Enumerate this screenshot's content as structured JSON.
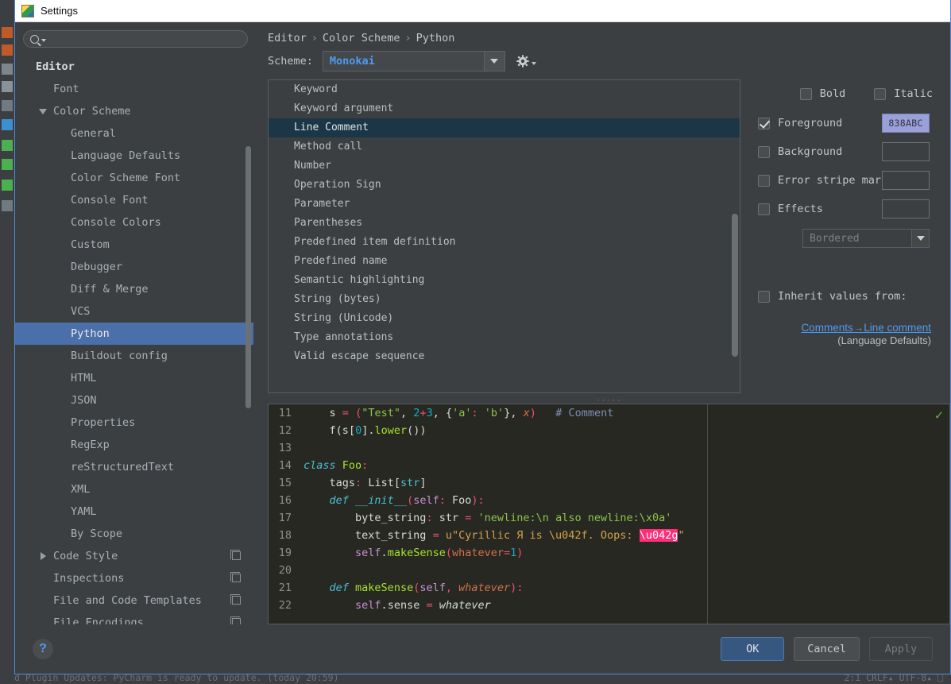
{
  "window": {
    "title": "Settings",
    "icon": "pycharm-icon"
  },
  "search": {
    "value": "",
    "placeholder": "",
    "icon": "search-icon"
  },
  "sidebar": {
    "items": [
      {
        "label": "Editor",
        "indent": 0,
        "bold": true,
        "twisty": "none",
        "selected": false,
        "copy": false
      },
      {
        "label": "Font",
        "indent": 1,
        "bold": false,
        "twisty": "none",
        "selected": false,
        "copy": false
      },
      {
        "label": "Color Scheme",
        "indent": 1,
        "bold": false,
        "twisty": "down",
        "selected": false,
        "copy": false
      },
      {
        "label": "General",
        "indent": 2,
        "bold": false,
        "twisty": "none",
        "selected": false,
        "copy": false
      },
      {
        "label": "Language Defaults",
        "indent": 2,
        "bold": false,
        "twisty": "none",
        "selected": false,
        "copy": false
      },
      {
        "label": "Color Scheme Font",
        "indent": 2,
        "bold": false,
        "twisty": "none",
        "selected": false,
        "copy": false
      },
      {
        "label": "Console Font",
        "indent": 2,
        "bold": false,
        "twisty": "none",
        "selected": false,
        "copy": false
      },
      {
        "label": "Console Colors",
        "indent": 2,
        "bold": false,
        "twisty": "none",
        "selected": false,
        "copy": false
      },
      {
        "label": "Custom",
        "indent": 2,
        "bold": false,
        "twisty": "none",
        "selected": false,
        "copy": false
      },
      {
        "label": "Debugger",
        "indent": 2,
        "bold": false,
        "twisty": "none",
        "selected": false,
        "copy": false
      },
      {
        "label": "Diff & Merge",
        "indent": 2,
        "bold": false,
        "twisty": "none",
        "selected": false,
        "copy": false
      },
      {
        "label": "VCS",
        "indent": 2,
        "bold": false,
        "twisty": "none",
        "selected": false,
        "copy": false
      },
      {
        "label": "Python",
        "indent": 2,
        "bold": false,
        "twisty": "none",
        "selected": true,
        "copy": false
      },
      {
        "label": "Buildout config",
        "indent": 2,
        "bold": false,
        "twisty": "none",
        "selected": false,
        "copy": false
      },
      {
        "label": "HTML",
        "indent": 2,
        "bold": false,
        "twisty": "none",
        "selected": false,
        "copy": false
      },
      {
        "label": "JSON",
        "indent": 2,
        "bold": false,
        "twisty": "none",
        "selected": false,
        "copy": false
      },
      {
        "label": "Properties",
        "indent": 2,
        "bold": false,
        "twisty": "none",
        "selected": false,
        "copy": false
      },
      {
        "label": "RegExp",
        "indent": 2,
        "bold": false,
        "twisty": "none",
        "selected": false,
        "copy": false
      },
      {
        "label": "reStructuredText",
        "indent": 2,
        "bold": false,
        "twisty": "none",
        "selected": false,
        "copy": false
      },
      {
        "label": "XML",
        "indent": 2,
        "bold": false,
        "twisty": "none",
        "selected": false,
        "copy": false
      },
      {
        "label": "YAML",
        "indent": 2,
        "bold": false,
        "twisty": "none",
        "selected": false,
        "copy": false
      },
      {
        "label": "By Scope",
        "indent": 2,
        "bold": false,
        "twisty": "none",
        "selected": false,
        "copy": false
      },
      {
        "label": "Code Style",
        "indent": 1,
        "bold": false,
        "twisty": "right",
        "selected": false,
        "copy": true
      },
      {
        "label": "Inspections",
        "indent": 1,
        "bold": false,
        "twisty": "none",
        "selected": false,
        "copy": true
      },
      {
        "label": "File and Code Templates",
        "indent": 1,
        "bold": false,
        "twisty": "none",
        "selected": false,
        "copy": true
      },
      {
        "label": "File Encodings",
        "indent": 1,
        "bold": false,
        "twisty": "none",
        "selected": false,
        "copy": true
      }
    ]
  },
  "breadcrumb": {
    "parts": [
      "Editor",
      "Color Scheme",
      "Python"
    ],
    "separator": "›"
  },
  "scheme": {
    "label": "Scheme:",
    "value": "Monokai",
    "dropdown_icon": "chevron-down-icon",
    "gear_icon": "gear-icon"
  },
  "attributes": {
    "items": [
      {
        "label": "Keyword",
        "selected": false
      },
      {
        "label": "Keyword argument",
        "selected": false
      },
      {
        "label": "Line Comment",
        "selected": true
      },
      {
        "label": "Method call",
        "selected": false
      },
      {
        "label": "Number",
        "selected": false
      },
      {
        "label": "Operation Sign",
        "selected": false
      },
      {
        "label": "Parameter",
        "selected": false
      },
      {
        "label": "Parentheses",
        "selected": false
      },
      {
        "label": "Predefined item definition",
        "selected": false
      },
      {
        "label": "Predefined name",
        "selected": false
      },
      {
        "label": "Semantic highlighting",
        "selected": false
      },
      {
        "label": "String (bytes)",
        "selected": false
      },
      {
        "label": "String (Unicode)",
        "selected": false
      },
      {
        "label": "Type annotations",
        "selected": false
      },
      {
        "label": "Valid escape sequence",
        "selected": false
      }
    ]
  },
  "properties": {
    "bold": {
      "label": "Bold",
      "checked": false
    },
    "italic": {
      "label": "Italic",
      "checked": false
    },
    "foreground": {
      "label": "Foreground",
      "checked": true,
      "color_value": "838ABC",
      "swatch_color": "#9aa0d8"
    },
    "background": {
      "label": "Background",
      "checked": false,
      "color_value": ""
    },
    "error_stripe": {
      "label": "Error stripe mark",
      "checked": false,
      "color_value": ""
    },
    "effects": {
      "label": "Effects",
      "checked": false,
      "color_value": ""
    },
    "effect_type": {
      "value": "Bordered",
      "dropdown_icon": "chevron-down-icon"
    },
    "inherit": {
      "label": "Inherit values from:",
      "checked": false
    },
    "inherit_link": "Comments→Line comment",
    "inherit_source": "(Language Defaults)"
  },
  "preview": {
    "grip_icon": "resize-grip",
    "status_icon": "inspection-ok-checkmark",
    "lines": [
      {
        "n": "11",
        "tokens": [
          {
            "t": "    ",
            "c": "t-dot"
          },
          {
            "t": "s",
            "c": "t-def"
          },
          {
            "t": " ",
            "c": "t-def"
          },
          {
            "t": "=",
            "c": "t-op"
          },
          {
            "t": " ",
            "c": "t-def"
          },
          {
            "t": "(",
            "c": "t-punct"
          },
          {
            "t": "\"Test\"",
            "c": "t-str"
          },
          {
            "t": ",",
            "c": "t-def"
          },
          {
            "t": " ",
            "c": "t-def"
          },
          {
            "t": "2",
            "c": "t-num"
          },
          {
            "t": "+",
            "c": "t-op"
          },
          {
            "t": "3",
            "c": "t-num"
          },
          {
            "t": ",",
            "c": "t-def"
          },
          {
            "t": " ",
            "c": "t-def"
          },
          {
            "t": "{",
            "c": "t-def"
          },
          {
            "t": "'a'",
            "c": "t-str"
          },
          {
            "t": ":",
            "c": "t-punct"
          },
          {
            "t": " ",
            "c": "t-def"
          },
          {
            "t": "'b'",
            "c": "t-str"
          },
          {
            "t": "}",
            "c": "t-def"
          },
          {
            "t": ",",
            "c": "t-def"
          },
          {
            "t": " ",
            "c": "t-def"
          },
          {
            "t": "x",
            "c": "t-param"
          },
          {
            "t": ")",
            "c": "t-punct"
          },
          {
            "t": "   ",
            "c": "t-def"
          },
          {
            "t": "# Comment",
            "c": "t-cmt"
          }
        ]
      },
      {
        "n": "12",
        "tokens": [
          {
            "t": "    ",
            "c": "t-dot"
          },
          {
            "t": "f",
            "c": "t-def"
          },
          {
            "t": "(",
            "c": "t-def"
          },
          {
            "t": "s",
            "c": "t-def"
          },
          {
            "t": "[",
            "c": "t-def"
          },
          {
            "t": "0",
            "c": "t-num"
          },
          {
            "t": "]",
            "c": "t-def"
          },
          {
            "t": ".",
            "c": "t-def"
          },
          {
            "t": "lower",
            "c": "t-fn"
          },
          {
            "t": "()",
            "c": "t-def"
          },
          {
            "t": ")",
            "c": "t-def"
          }
        ]
      },
      {
        "n": "13",
        "tokens": []
      },
      {
        "n": "14",
        "tokens": [
          {
            "t": "class",
            "c": "t-kw"
          },
          {
            "t": " ",
            "c": "t-def"
          },
          {
            "t": "Foo",
            "c": "t-cls"
          },
          {
            "t": ":",
            "c": "t-punct"
          }
        ]
      },
      {
        "n": "15",
        "tokens": [
          {
            "t": "    ",
            "c": "t-dot"
          },
          {
            "t": "tags",
            "c": "t-def"
          },
          {
            "t": ":",
            "c": "t-punct"
          },
          {
            "t": " ",
            "c": "t-def"
          },
          {
            "t": "List",
            "c": "t-def"
          },
          {
            "t": "[",
            "c": "t-def"
          },
          {
            "t": "str",
            "c": "t-ann"
          },
          {
            "t": "]",
            "c": "t-def"
          }
        ]
      },
      {
        "n": "16",
        "tokens": [
          {
            "t": "    ",
            "c": "t-dot"
          },
          {
            "t": "def",
            "c": "t-kw"
          },
          {
            "t": " ",
            "c": "t-def"
          },
          {
            "t": "__init__",
            "c": "t-kw"
          },
          {
            "t": "(",
            "c": "t-punct"
          },
          {
            "t": "self",
            "c": "t-self"
          },
          {
            "t": ":",
            "c": "t-punct"
          },
          {
            "t": " ",
            "c": "t-def"
          },
          {
            "t": "Foo",
            "c": "t-def"
          },
          {
            "t": ")",
            "c": "t-punct"
          },
          {
            "t": ":",
            "c": "t-punct"
          }
        ]
      },
      {
        "n": "17",
        "tokens": [
          {
            "t": "        ",
            "c": "t-dot"
          },
          {
            "t": "byte_string",
            "c": "t-def"
          },
          {
            "t": ":",
            "c": "t-punct"
          },
          {
            "t": " ",
            "c": "t-def"
          },
          {
            "t": "str",
            "c": "t-def"
          },
          {
            "t": " ",
            "c": "t-def"
          },
          {
            "t": "=",
            "c": "t-op"
          },
          {
            "t": " ",
            "c": "t-def"
          },
          {
            "t": "'newline:\\n also newline:\\x0a'",
            "c": "t-str"
          }
        ]
      },
      {
        "n": "18",
        "tokens": [
          {
            "t": "        ",
            "c": "t-dot"
          },
          {
            "t": "text_string",
            "c": "t-def"
          },
          {
            "t": " ",
            "c": "t-def"
          },
          {
            "t": "=",
            "c": "t-op"
          },
          {
            "t": " ",
            "c": "t-def"
          },
          {
            "t": "u\"Cyrillic Я is \\u042f. Oops: ",
            "c": "t-ustr"
          },
          {
            "t": "\\u042g",
            "c": "t-err"
          },
          {
            "t": "\"",
            "c": "t-ustr"
          }
        ]
      },
      {
        "n": "19",
        "tokens": [
          {
            "t": "        ",
            "c": "t-dot"
          },
          {
            "t": "self",
            "c": "t-self"
          },
          {
            "t": ".",
            "c": "t-def"
          },
          {
            "t": "makeSense",
            "c": "t-fn"
          },
          {
            "t": "(",
            "c": "t-punct"
          },
          {
            "t": "whatever",
            "c": "t-kwarg"
          },
          {
            "t": "=",
            "c": "t-op"
          },
          {
            "t": "1",
            "c": "t-num"
          },
          {
            "t": ")",
            "c": "t-punct"
          }
        ]
      },
      {
        "n": "20",
        "tokens": []
      },
      {
        "n": "21",
        "tokens": [
          {
            "t": "    ",
            "c": "t-dot"
          },
          {
            "t": "def",
            "c": "t-kw"
          },
          {
            "t": " ",
            "c": "t-def"
          },
          {
            "t": "makeSense",
            "c": "t-fn"
          },
          {
            "t": "(",
            "c": "t-punct"
          },
          {
            "t": "self",
            "c": "t-self"
          },
          {
            "t": ",",
            "c": "t-punct"
          },
          {
            "t": " ",
            "c": "t-def"
          },
          {
            "t": "whatever",
            "c": "t-param"
          },
          {
            "t": ")",
            "c": "t-punct"
          },
          {
            "t": ":",
            "c": "t-punct"
          }
        ]
      },
      {
        "n": "22",
        "tokens": [
          {
            "t": "        ",
            "c": "t-dot"
          },
          {
            "t": "self",
            "c": "t-self"
          },
          {
            "t": ".",
            "c": "t-def"
          },
          {
            "t": "sense",
            "c": "t-def"
          },
          {
            "t": " ",
            "c": "t-def"
          },
          {
            "t": "=",
            "c": "t-op"
          },
          {
            "t": " ",
            "c": "t-def"
          },
          {
            "t": "whatever",
            "c": "t-ital"
          }
        ]
      }
    ]
  },
  "footer": {
    "help_label": "?",
    "ok_label": "OK",
    "cancel_label": "Cancel",
    "apply_label": "Apply"
  },
  "ide_status": {
    "left": "d Plugin Updates: PyCharm is ready to update.  (today 20:59)",
    "right": "2:1   CRLF▴  UTF-8▴   ⎕"
  },
  "colors": {
    "accent": "#4e9bf0",
    "selection": "#4a6fa9",
    "list_selection": "#1b3747",
    "dialog_bg": "#3c3f41",
    "editor_bg": "#272822",
    "error_highlight": "#ff2d78"
  }
}
